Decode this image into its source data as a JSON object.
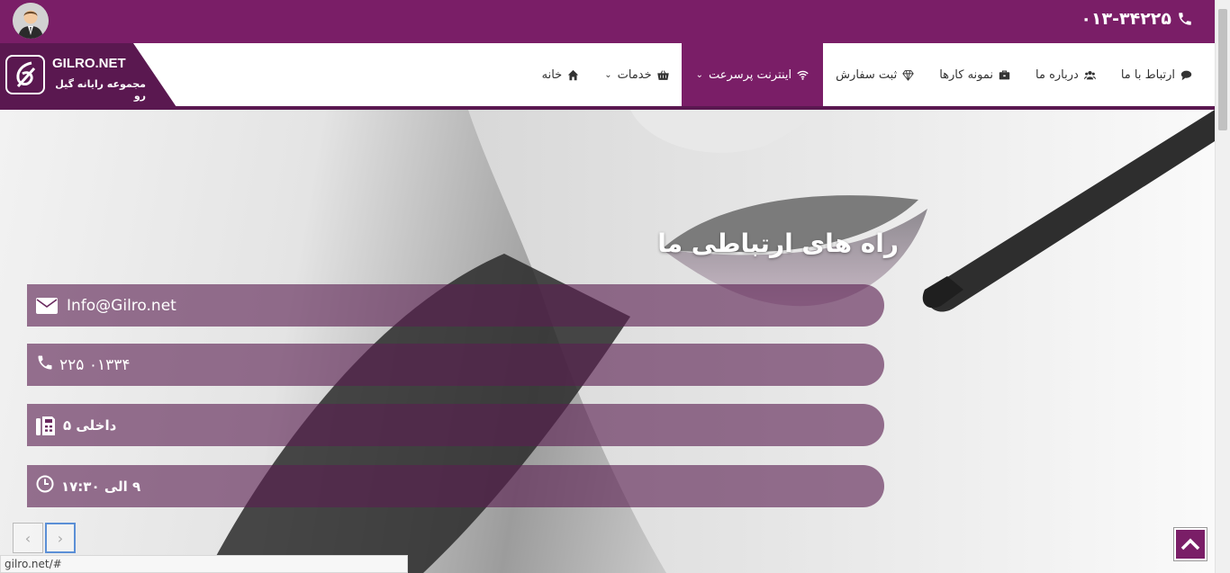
{
  "topbar": {
    "phone": "۰۱۳-۳۴۲۲۵"
  },
  "logo": {
    "title": "GILRO.NET",
    "subtitle": "مجموعه رایانه گیل رو"
  },
  "menu": {
    "items": [
      {
        "label": "خانه",
        "icon": "home-icon"
      },
      {
        "label": "خدمات",
        "icon": "basket-icon"
      },
      {
        "label": "اینترنت پرسرعت",
        "icon": "wifi-icon"
      },
      {
        "label": "ثبت سفارش",
        "icon": "diamond-icon"
      },
      {
        "label": "نمونه کارها",
        "icon": "briefcase-icon"
      },
      {
        "label": "درباره ما",
        "icon": "users-icon"
      },
      {
        "label": "ارتباط با ما",
        "icon": "comment-icon"
      }
    ]
  },
  "hero": {
    "title": "راه های ارتباطی ما",
    "email": "Info@Gilro.net",
    "phone": "۰۱۳۳۴ ۲۲۵",
    "extension": "داخلی ۵",
    "hours": "۹ الی ۱۷:۳۰"
  },
  "status": {
    "url": "gilro.net/#"
  },
  "colors": {
    "brand": "#7a1e67",
    "brand_dark": "#5a1850"
  }
}
